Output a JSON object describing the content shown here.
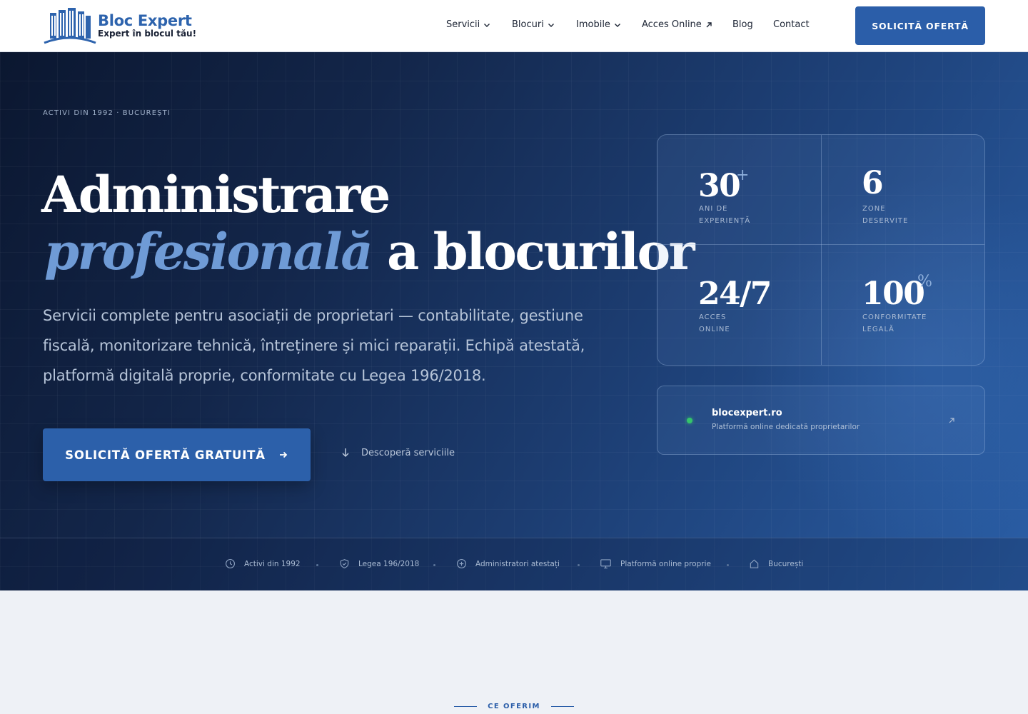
{
  "brand": {
    "name": "Bloc Expert",
    "tagline": "Expert în blocul tău!",
    "accent": "#2b5ea9"
  },
  "nav": {
    "items": [
      {
        "label": "Servicii",
        "icon": "chevron-down-icon"
      },
      {
        "label": "Blocuri",
        "icon": "chevron-down-icon"
      },
      {
        "label": "Imobile",
        "icon": "chevron-down-icon"
      },
      {
        "label": "Acces Online",
        "icon": "external-arrow-icon"
      },
      {
        "label": "Blog"
      },
      {
        "label": "Contact"
      }
    ],
    "cta_label": "SOLICITĂ OFERTĂ"
  },
  "hero": {
    "eyebrow": "ACTIVI DIN 1992 · BUCUREȘTI",
    "title_line1": "Administrare",
    "title_italic": "profesională",
    "title_rest": "a blocurilor",
    "lead": "Servicii complete pentru asociații de proprietari — contabilitate, gestiune fiscală, monitorizare tehnică, întreținere și mici reparații. Echipă atestată, platformă digitală proprie, conformitate cu Legea 196/2018.",
    "cta_label": "SOLICITĂ OFERTĂ GRATUITĂ",
    "secondary_label": "Descoperă serviciile"
  },
  "stats": [
    {
      "value": "30",
      "suffix": "+",
      "label": "ANI DE EXPERIENȚĂ"
    },
    {
      "value": "6",
      "suffix": "",
      "label": "ZONE DESERVITE"
    },
    {
      "value": "24/7",
      "suffix": "",
      "label": "ACCES ONLINE"
    },
    {
      "value": "100",
      "suffix": "%",
      "label": "CONFORMITATE LEGALĂ"
    }
  ],
  "site_card": {
    "title": "blocexpert.ro",
    "subtitle": "Platformă online dedicată proprietarilor",
    "status_color": "#35c46b"
  },
  "trust": [
    {
      "icon": "clock-icon",
      "label": "Activi din 1992"
    },
    {
      "icon": "shield-check-icon",
      "label": "Legea 196/2018"
    },
    {
      "icon": "plus-circle-icon",
      "label": "Administratori atestați"
    },
    {
      "icon": "monitor-icon",
      "label": "Platformă online proprie"
    },
    {
      "icon": "home-icon",
      "label": "București"
    }
  ],
  "next_section": {
    "eyebrow": "CE OFERIM"
  }
}
